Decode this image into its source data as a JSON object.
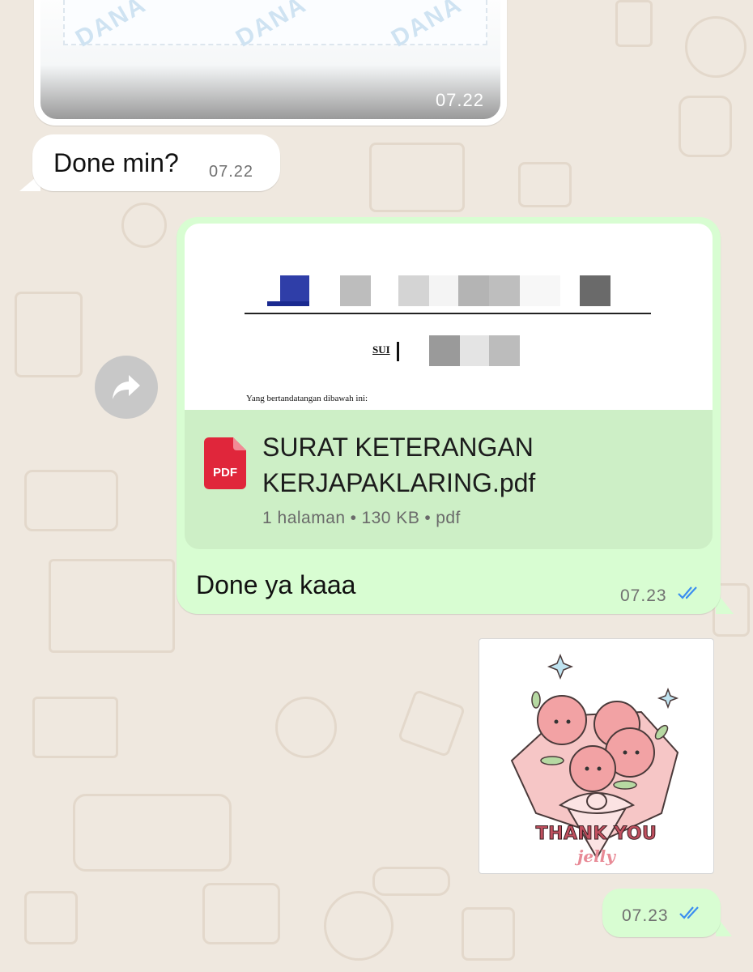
{
  "chat": {
    "top_image": {
      "watermark": "DANA",
      "time": "07.22"
    },
    "incoming_message": {
      "text": "Done min?",
      "time": "07.22"
    },
    "document_message": {
      "preview": {
        "header_fragment": "SUI",
        "body_line": "Yang bertandatangan dibawah ini:"
      },
      "file_icon_label": "PDF",
      "file_name": "SURAT KETERANGAN KERJAPAKLARING.pdf",
      "meta": {
        "pages": "1 halaman",
        "size": "130 KB",
        "type": "pdf"
      },
      "caption": "Done ya kaaa",
      "time": "07.23",
      "status": "read"
    },
    "sticker": {
      "line1": "THANK YOU",
      "line2": "jelly"
    },
    "sticker_time": {
      "time": "07.23",
      "status": "read"
    }
  },
  "colors": {
    "wallpaper": "#efe8df",
    "outgoing_bubble": "#d8fdd2",
    "incoming_bubble": "#ffffff",
    "read_ticks": "#3b8ef0",
    "pdf_red": "#e0263b"
  },
  "icons": [
    "forward-icon",
    "pdf-file-icon",
    "double-check-icon"
  ]
}
